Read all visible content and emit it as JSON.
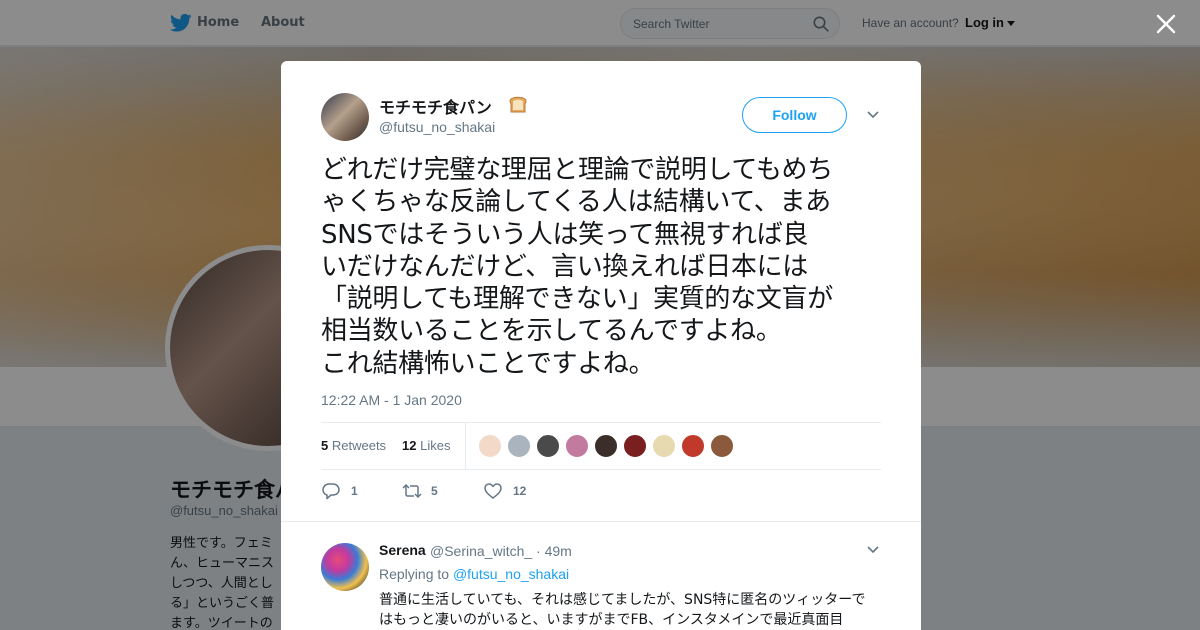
{
  "nav": {
    "home_label": "Home",
    "about_label": "About",
    "search_placeholder": "Search Twitter",
    "have_account": "Have an account?",
    "login_label": "Log in"
  },
  "profile": {
    "name": "モチモチ食パ",
    "handle": "@futsu_no_shakai",
    "bio": "男性です。フェミ\nん、ヒューマニス\nしつつ、人間とし\nる」というごく普\nます。ツイートの"
  },
  "tweet": {
    "author_name": "モチモチ食パン",
    "author_handle": "@futsu_no_shakai",
    "follow_label": "Follow",
    "text": "どれだけ完璧な理屈と理論で説明してもめち\nゃくちゃな反論してくる人は結構いて、まあ\nSNSではそういう人は笑って無視すれば良\nいだけなんだけど、言い換えれば日本には\n「説明しても理解できない」実質的な文盲が\n相当数いることを示してるんですよね。\nこれ結構怖いことですよね。",
    "timestamp": "12:22 AM - 1 Jan 2020",
    "retweets_count": "5",
    "retweets_label": "Retweets",
    "likes_count": "12",
    "likes_label": "Likes",
    "likers": [
      "#f3d9c8",
      "#a9b4bf",
      "#4a4a4a",
      "#c27a9e",
      "#3b2e2a",
      "#7a1f1f",
      "#e7d9b0",
      "#c0392b",
      "#8b5a3c"
    ],
    "actions": {
      "reply_count": "1",
      "retweet_count": "5",
      "like_count": "12"
    }
  },
  "reply": {
    "name": "Serena",
    "handle_time": "@Serina_witch_ · 49m",
    "replying_prefix": "Replying to ",
    "replying_to": "@futsu_no_shakai",
    "text": "普通に生活していても、それは感じてましたが、SNS特に匿名のツィッターで\nはもっと凄いのがいると、いますがまでFB、インスタメインで最近真面目"
  },
  "colors": {
    "brand": "#1da1f2",
    "text": "#14171a",
    "muted": "#657786"
  }
}
